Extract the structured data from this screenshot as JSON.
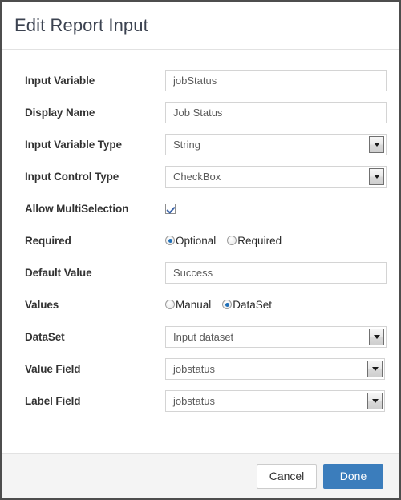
{
  "dialog": {
    "title": "Edit Report Input",
    "accent_color": "#3b7dbc",
    "border_color": "#4d4d4d",
    "footer_bg": "#f4f4f4"
  },
  "form": {
    "input_variable": {
      "label": "Input Variable",
      "value": "jobStatus",
      "placeholder": "jobStatus"
    },
    "display_name": {
      "label": "Display Name",
      "value": "Job Status",
      "placeholder": "Job Status"
    },
    "input_variable_type": {
      "label": "Input Variable Type",
      "value": "String"
    },
    "input_control_type": {
      "label": "Input Control Type",
      "value": "CheckBox"
    },
    "allow_multiselection": {
      "label": "Allow MultiSelection",
      "checked": true
    },
    "required": {
      "label": "Required",
      "options": [
        {
          "label": "Optional",
          "selected": true
        },
        {
          "label": "Required",
          "selected": false
        }
      ]
    },
    "default_value": {
      "label": "Default Value",
      "value": "Success",
      "placeholder": "Success"
    },
    "values": {
      "label": "Values",
      "options": [
        {
          "label": "Manual",
          "selected": false
        },
        {
          "label": "DataSet",
          "selected": true
        }
      ]
    },
    "dataset": {
      "label": "DataSet",
      "value": "Input dataset"
    },
    "value_field": {
      "label": "Value Field",
      "value": "jobstatus"
    },
    "label_field": {
      "label": "Label Field",
      "value": "jobstatus"
    }
  },
  "footer": {
    "cancel_label": "Cancel",
    "done_label": "Done"
  }
}
